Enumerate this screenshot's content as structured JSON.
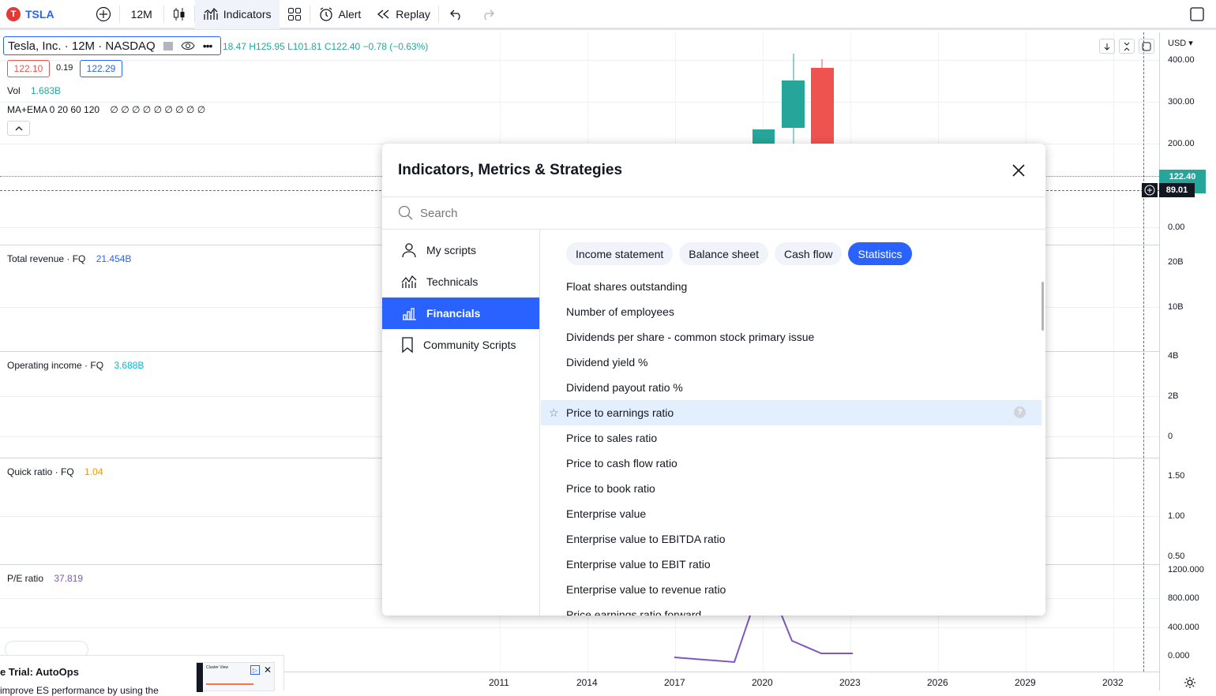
{
  "topbar": {
    "symbol": "TSLA",
    "interval": "12M",
    "indicators_label": "Indicators",
    "alert_label": "Alert",
    "replay_label": "Replay"
  },
  "legend": {
    "title": "Tesla, Inc. · 12M · NASDAQ",
    "ohlc_open": "18.47",
    "ohlc_high": "H125.95",
    "ohlc_low": "L101.81",
    "ohlc_close": "C122.40",
    "ohlc_change": "−0.78 (−0.63%)",
    "bid": "122.10",
    "spread": "0.19",
    "ask": "122.29",
    "vol_label": "Vol",
    "vol_value": "1.683B",
    "ma_label": "MA+EMA 0 20 60 120",
    "ma_values": "∅ ∅ ∅ ∅ ∅ ∅ ∅ ∅ ∅"
  },
  "panes": {
    "revenue_label": "Total revenue · FQ",
    "revenue_value": "21.454B",
    "opincome_label": "Operating income · FQ",
    "opincome_value": "3.688B",
    "quick_label": "Quick ratio · FQ",
    "quick_value": "1.04",
    "pe_label": "P/E ratio",
    "pe_value": "37.819"
  },
  "price_scale": {
    "currency": "USD",
    "ticks_main": [
      "400.00",
      "300.00",
      "200.00",
      "0.00"
    ],
    "last_price": "122.40",
    "crosshair_price": "89.01",
    "ticks_revenue": [
      "20B",
      "10B"
    ],
    "ticks_opincome": [
      "4B",
      "2B",
      "0"
    ],
    "ticks_quick": [
      "1.50",
      "1.00",
      "0.50"
    ],
    "ticks_pe": [
      "1200.000",
      "800.000",
      "400.000",
      "0.000"
    ]
  },
  "time_scale": [
    "2011",
    "2014",
    "2017",
    "2020",
    "2023",
    "2026",
    "2029",
    "2032"
  ],
  "dialog": {
    "title": "Indicators, Metrics & Strategies",
    "search_placeholder": "Search",
    "sidebar": [
      {
        "label": "My scripts",
        "icon": "user-icon"
      },
      {
        "label": "Technicals",
        "icon": "chart-icon"
      },
      {
        "label": "Financials",
        "icon": "bar-chart-icon",
        "selected": true
      },
      {
        "label": "Community Scripts",
        "icon": "bookmark-icon"
      }
    ],
    "tabs": [
      "Income statement",
      "Balance sheet",
      "Cash flow",
      "Statistics"
    ],
    "selected_tab": "Statistics",
    "items": [
      "Float shares outstanding",
      "Number of employees",
      "Dividends per share - common stock primary issue",
      "Dividend yield %",
      "Dividend payout ratio %",
      "Price to earnings ratio",
      "Price to sales ratio",
      "Price to cash flow ratio",
      "Price to book ratio",
      "Enterprise value",
      "Enterprise value to EBITDA ratio",
      "Enterprise value to EBIT ratio",
      "Enterprise value to revenue ratio",
      "Price earnings ratio forward"
    ],
    "highlighted_item": "Price to earnings ratio"
  },
  "ad": {
    "title": "e Trial: AutoOps",
    "subtitle": "improve ES performance by using the",
    "thumb_title": "Cluster View"
  },
  "colors": {
    "accent": "#2962ff",
    "up": "#26a69a",
    "down": "#ef5350",
    "pe_line": "#7e57c2",
    "revenue_value": "#2962ff",
    "opincome_value": "#00bcd4",
    "quick_value": "#ff9800"
  }
}
